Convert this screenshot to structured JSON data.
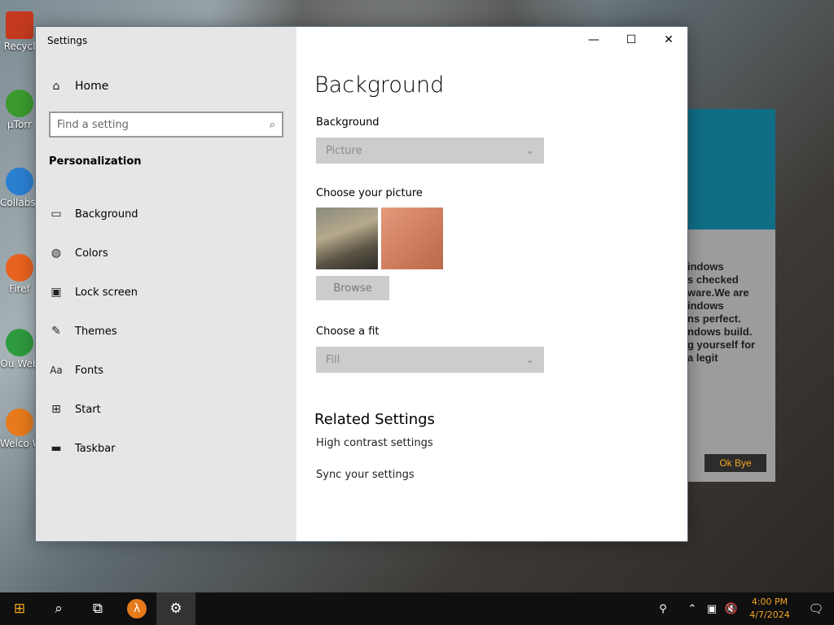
{
  "window": {
    "title": "Settings",
    "controls": [
      "minimize-icon",
      "maximize-icon",
      "close-icon"
    ]
  },
  "sidebar": {
    "home_label": "Home",
    "search_placeholder": "Find a setting",
    "section_title": "Personalization",
    "items": [
      {
        "label": "Background",
        "icon": "picture-icon"
      },
      {
        "label": "Colors",
        "icon": "palette-icon"
      },
      {
        "label": "Lock screen",
        "icon": "lock-screen-icon"
      },
      {
        "label": "Themes",
        "icon": "themes-icon"
      },
      {
        "label": "Fonts",
        "icon": "fonts-icon"
      },
      {
        "label": "Start",
        "icon": "start-icon"
      },
      {
        "label": "Taskbar",
        "icon": "taskbar-icon"
      }
    ]
  },
  "main": {
    "page_title": "Background",
    "background_label": "Background",
    "background_value": "Picture",
    "choose_picture_label": "Choose your picture",
    "browse_label": "Browse",
    "fit_label": "Choose a fit",
    "fit_value": "Fill",
    "related_title": "Related Settings",
    "links": [
      "High contrast settings",
      "Sync your settings"
    ]
  },
  "desktop": {
    "icons": [
      "Recycl",
      "µTorr",
      "Collabs Spon",
      "Firef",
      "Ou Web",
      "Welco Windo"
    ],
    "popup_text": [
      "indows",
      "s checked",
      "ware.We are",
      "indows",
      "ns perfect.",
      "ndows build.",
      "g yourself for",
      "a legit"
    ],
    "popup_button": "Ok Bye"
  },
  "taskbar": {
    "time": "4:00 PM",
    "date": "4/7/2024",
    "colors": {
      "clock": "#f4a520",
      "bar": "#101010"
    }
  }
}
